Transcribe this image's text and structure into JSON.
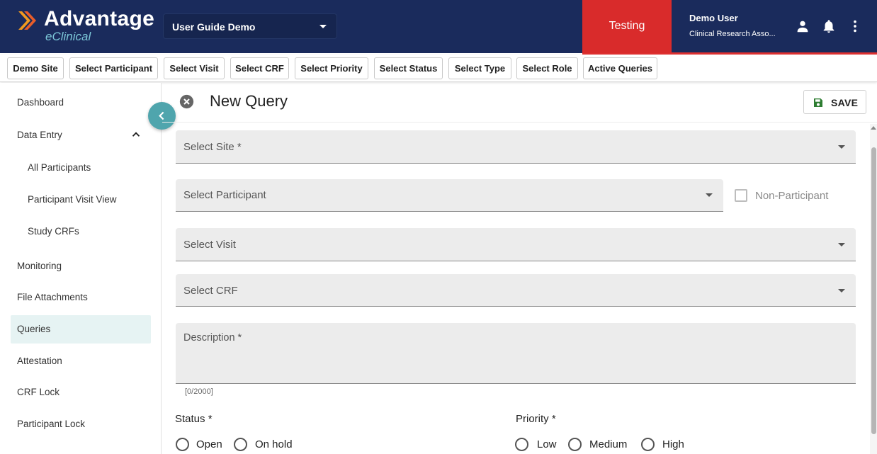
{
  "header": {
    "logo_title": "Advantage",
    "logo_subtitle": "eClinical",
    "study_select": "User Guide Demo",
    "environment": "Testing",
    "user_name": "Demo User",
    "user_role": "Clinical Research Asso...",
    "icons": [
      "person-icon",
      "bell-icon",
      "more-vert-icon"
    ]
  },
  "filters": [
    "Demo Site",
    "Select Participant",
    "Select Visit",
    "Select CRF",
    "Select Priority",
    "Select Status",
    "Select Type",
    "Select Role",
    "Active Queries"
  ],
  "sidebar": {
    "items": [
      {
        "label": "Dashboard"
      },
      {
        "label": "Data Entry"
      },
      {
        "label": "All Participants"
      },
      {
        "label": "Participant Visit View"
      },
      {
        "label": "Study CRFs"
      },
      {
        "label": "Monitoring"
      },
      {
        "label": "File Attachments"
      },
      {
        "label": "Queries"
      },
      {
        "label": "Attestation"
      },
      {
        "label": "CRF Lock"
      },
      {
        "label": "Participant Lock"
      }
    ],
    "active": "Queries"
  },
  "form": {
    "title": "New Query",
    "save_label": "SAVE",
    "site_label": "Select Site *",
    "participant_label": "Select Participant",
    "non_participant_label": "Non-Participant",
    "non_participant_checked": false,
    "visit_label": "Select Visit",
    "crf_label": "Select CRF",
    "description_label": "Description *",
    "description_counter": "[0/2000]",
    "status_label": "Status *",
    "status_options": [
      "Open",
      "On hold"
    ],
    "priority_label": "Priority *",
    "priority_options": [
      "Low",
      "Medium",
      "High"
    ]
  },
  "colors": {
    "header_bg": "#1a2b5c",
    "env_badge": "#d92b2b",
    "accent_teal": "#4fa5ad",
    "active_item_bg": "#e6f3f3",
    "save_icon": "#2e7d32"
  }
}
